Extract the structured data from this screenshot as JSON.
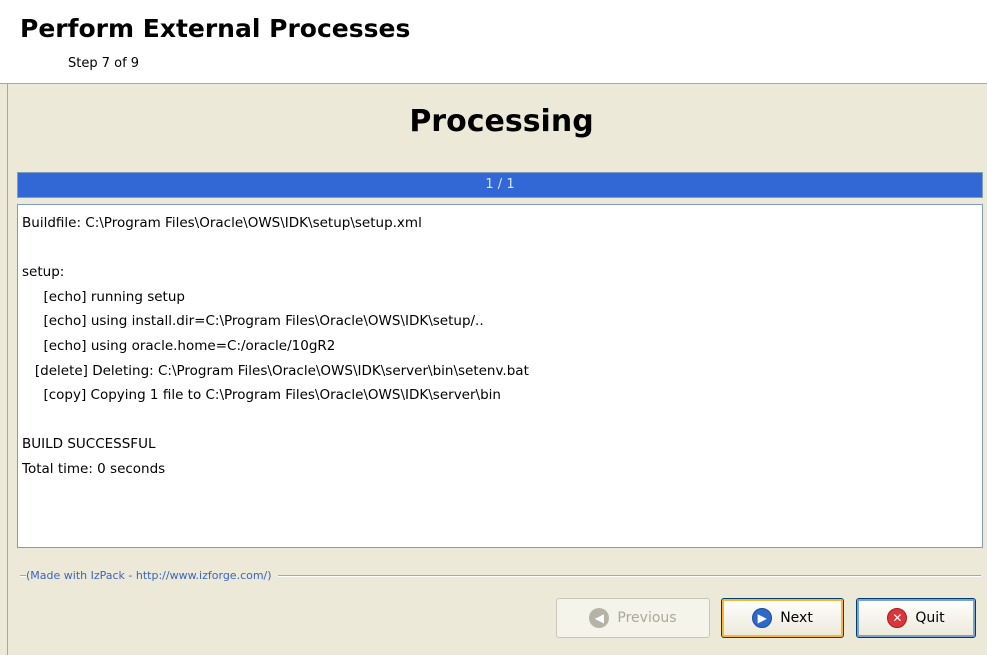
{
  "header": {
    "title": "Perform External Processes",
    "step": "Step 7 of 9"
  },
  "panel": {
    "title": "Processing"
  },
  "progress": {
    "text": "1 / 1",
    "fraction": 1.0
  },
  "log": {
    "lines": [
      "Buildfile: C:\\Program Files\\Oracle\\OWS\\IDK\\setup\\setup.xml",
      "",
      "setup:",
      "     [echo] running setup",
      "     [echo] using install.dir=C:\\Program Files\\Oracle\\OWS\\IDK\\setup/..",
      "     [echo] using oracle.home=C:/oracle/10gR2",
      "   [delete] Deleting: C:\\Program Files\\Oracle\\OWS\\IDK\\server\\bin\\setenv.bat",
      "     [copy] Copying 1 file to C:\\Program Files\\Oracle\\OWS\\IDK\\server\\bin",
      "",
      "BUILD SUCCESSFUL",
      "Total time: 0 seconds"
    ]
  },
  "footer": {
    "credit": "(Made with IzPack - http://www.izforge.com/)"
  },
  "buttons": {
    "previous": "Previous",
    "next": "Next",
    "quit": "Quit"
  },
  "icons": {
    "previous": "arrow-left-icon",
    "next": "arrow-right-icon",
    "quit": "close-icon"
  }
}
